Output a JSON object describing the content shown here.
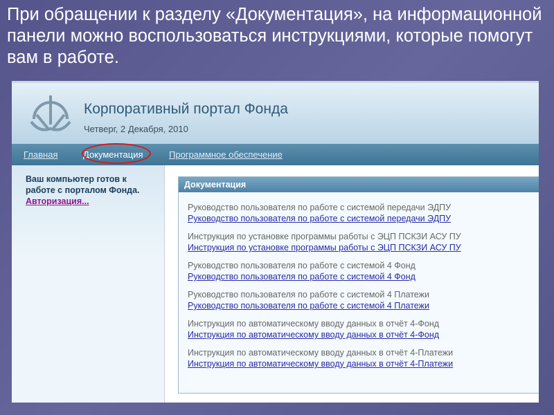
{
  "slide": {
    "title": "При обращении к разделу «Документация», на информационной панели можно воспользоваться инструкциями, которые помогут вам в работе."
  },
  "portal": {
    "title": "Корпоративный портал Фонда",
    "date": "Четверг, 2 Декабря, 2010"
  },
  "nav": [
    "Главная",
    "Документация",
    "Программное обеспечение"
  ],
  "sidebar": {
    "line1": "Ваш компьютер готов к",
    "line2": "работе с порталом Фонда.",
    "auth_link": "Авторизация..."
  },
  "panel": {
    "title": "Документация",
    "items": [
      {
        "text": "Руководство пользователя по работе с системой передачи ЭДПУ",
        "link": "Руководство пользователя по работе с системой передачи ЭДПУ"
      },
      {
        "text": "Инструкция по установке программы работы с ЭЦП ПСКЗИ АСУ ПУ",
        "link": "Инструкция по установке программы работы с ЭЦП ПСКЗИ АСУ ПУ"
      },
      {
        "text": "Руководство пользователя по работе с системой 4 Фонд",
        "link": "Руководство пользователя по работе с системой 4 Фонд"
      },
      {
        "text": "Руководство пользователя по работе с системой 4 Платежи",
        "link": "Руководство пользователя по работе с системой 4 Платежи"
      },
      {
        "text": "Инструкция по автоматическому вводу данных в отчёт 4-Фонд",
        "link": "Инструкция по автоматическому вводу данных в отчёт 4-Фонд"
      },
      {
        "text": "Инструкция по автоматическому вводу данных в отчёт 4-Платежи",
        "link": "Инструкция по автоматическому вводу данных в отчёт 4-Платежи"
      }
    ]
  }
}
